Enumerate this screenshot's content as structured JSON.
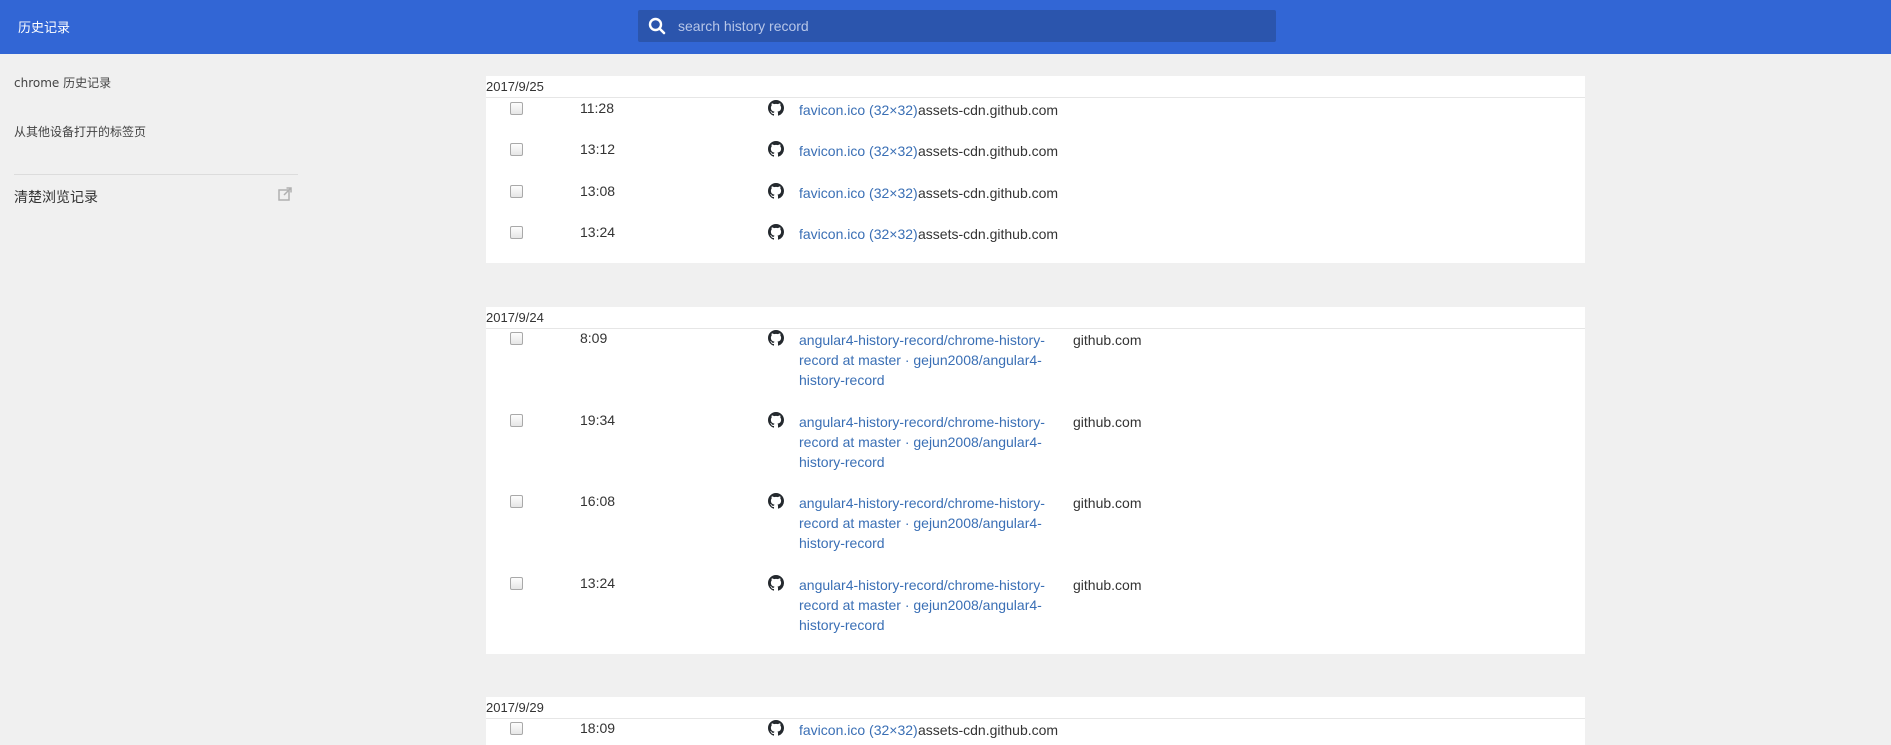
{
  "header": {
    "title": "历史记录",
    "search_placeholder": "search history record",
    "search_value": ""
  },
  "sidebar": {
    "items": [
      {
        "label": "chrome 历史记录"
      },
      {
        "label": "从其他设备打开的标签页"
      }
    ],
    "clear_label": "清楚浏览记录"
  },
  "groups": [
    {
      "date": "2017/9/25",
      "entries": [
        {
          "time": "11:28",
          "title": "favicon.ico (32×32)",
          "domain": "assets-cdn.github.com"
        },
        {
          "time": "13:12",
          "title": "favicon.ico (32×32)",
          "domain": "assets-cdn.github.com"
        },
        {
          "time": "13:08",
          "title": "favicon.ico (32×32)",
          "domain": "assets-cdn.github.com"
        },
        {
          "time": "13:24",
          "title": "favicon.ico (32×32)",
          "domain": "assets-cdn.github.com"
        }
      ]
    },
    {
      "date": "2017/9/24",
      "entries": [
        {
          "time": "8:09",
          "title": "angular4-history-record/chrome-history-record at master · gejun2008/angular4-history-record",
          "domain": "github.com"
        },
        {
          "time": "19:34",
          "title": "angular4-history-record/chrome-history-record at master · gejun2008/angular4-history-record",
          "domain": "github.com"
        },
        {
          "time": "16:08",
          "title": "angular4-history-record/chrome-history-record at master · gejun2008/angular4-history-record",
          "domain": "github.com"
        },
        {
          "time": "13:24",
          "title": "angular4-history-record/chrome-history-record at master · gejun2008/angular4-history-record",
          "domain": "github.com"
        }
      ]
    },
    {
      "date": "2017/9/29",
      "entries": [
        {
          "time": "18:09",
          "title": "favicon.ico (32×32)",
          "domain": "assets-cdn.github.com"
        }
      ]
    }
  ],
  "icons": {
    "search": "search-icon",
    "favicon": "github-icon",
    "external": "external-link-icon"
  },
  "colors": {
    "header_bg": "#3266d5",
    "search_bg": "#2b55ad",
    "link": "#3a6fb5",
    "page_bg": "#f0f0f0"
  }
}
